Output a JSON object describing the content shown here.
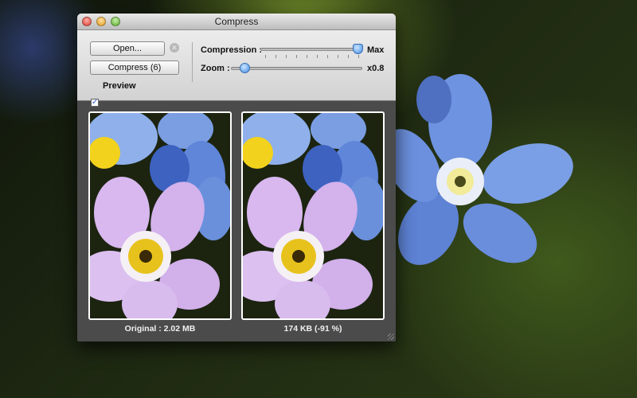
{
  "window": {
    "title": "Compress"
  },
  "toolbar": {
    "open_label": "Open...",
    "compress_label": "Compress (6)",
    "preview_label": "Preview",
    "preview_checked": true,
    "compression_label": "Compression :",
    "compression_value_label": "Max",
    "compression_fraction": 0.95,
    "zoom_label": "Zoom :",
    "zoom_value_label": "x0.8",
    "zoom_fraction": 0.1
  },
  "previews": {
    "original_caption": "Original : 2.02 MB",
    "compressed_caption": "174 KB (-91 %)"
  },
  "colors": {
    "accent": "#3e8ce6",
    "panel": "#4b4b4b"
  }
}
